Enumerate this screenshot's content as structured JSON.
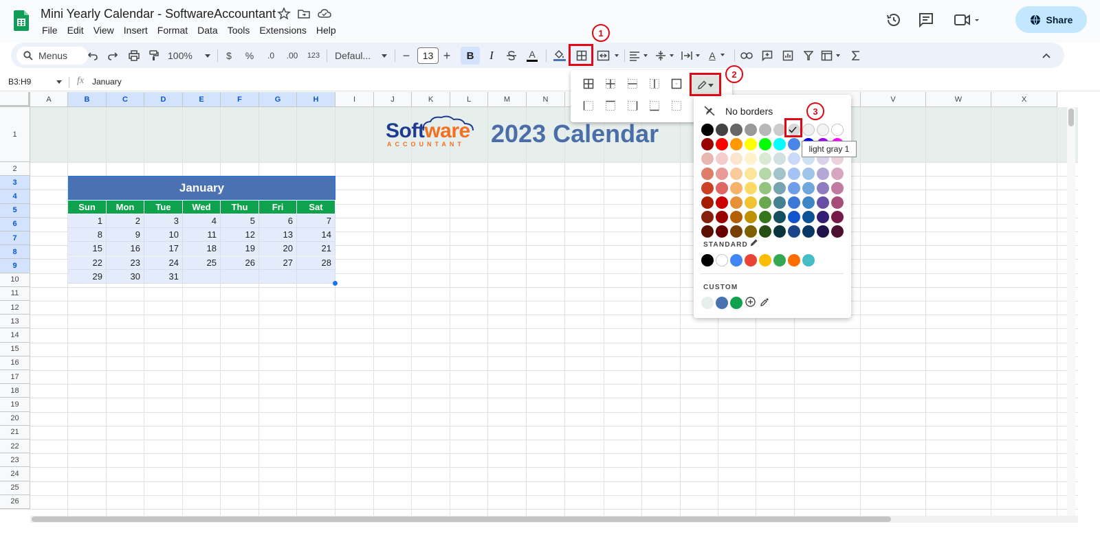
{
  "app": {
    "title": "Mini Yearly Calendar - SoftwareAccountant",
    "menu": [
      "File",
      "Edit",
      "View",
      "Insert",
      "Format",
      "Data",
      "Tools",
      "Extensions",
      "Help"
    ],
    "share_label": "Share"
  },
  "toolbar": {
    "search_label": "Menus",
    "zoom": "100%",
    "currency": "$",
    "percent": "%",
    "decimal_decrease": ".0",
    "decimal_increase": ".00",
    "number_format": "123",
    "font_name": "Defaul...",
    "font_size": "13",
    "bold": "B",
    "italic": "I",
    "text_color": "A",
    "text_rotate": "A",
    "minus": "−",
    "plus": "+"
  },
  "formula_bar": {
    "name_box": "B3:H9",
    "fx": "fx",
    "value": "January"
  },
  "columns": [
    "A",
    "B",
    "C",
    "D",
    "E",
    "F",
    "G",
    "H",
    "I",
    "J",
    "K",
    "L",
    "M",
    "N",
    "V",
    "W",
    "X"
  ],
  "rows": [
    "1",
    "2",
    "3",
    "4",
    "5",
    "6",
    "7",
    "8",
    "9",
    "10",
    "11",
    "12",
    "13",
    "14",
    "15",
    "16",
    "17",
    "18",
    "19",
    "20",
    "21",
    "22",
    "23",
    "24",
    "25",
    "26"
  ],
  "banner": {
    "logo_part1": "Soft",
    "logo_part2": "ware",
    "logo_sub": "ACCOUNTANT",
    "title": "2023 Calendar"
  },
  "calendar": {
    "month": "January",
    "days_of_week": [
      "Sun",
      "Mon",
      "Tue",
      "Wed",
      "Thu",
      "Fri",
      "Sat"
    ],
    "weeks": [
      [
        "1",
        "2",
        "3",
        "4",
        "5",
        "6",
        "7"
      ],
      [
        "8",
        "9",
        "10",
        "11",
        "12",
        "13",
        "14"
      ],
      [
        "15",
        "16",
        "17",
        "18",
        "19",
        "20",
        "21"
      ],
      [
        "22",
        "23",
        "24",
        "25",
        "26",
        "27",
        "28"
      ],
      [
        "29",
        "30",
        "31",
        "",
        "",
        "",
        ""
      ]
    ]
  },
  "border_color_popup": {
    "no_borders_label": "No borders",
    "standard_label": "STANDARD",
    "custom_label": "CUSTOM",
    "tooltip": "light gray 1",
    "selected_color": "light gray 1",
    "palette_rows": [
      [
        "#000000",
        "#434343",
        "#666666",
        "#999999",
        "#b7b7b7",
        "#cccccc",
        "#d9d9d9",
        "#efefef",
        "#f3f3f3",
        "#ffffff"
      ],
      [
        "#980000",
        "#ff0000",
        "#ff9900",
        "#ffff00",
        "#00ff00",
        "#00ffff",
        "#4a86e8",
        "#0000ff",
        "#9900ff",
        "#ff00ff"
      ],
      [
        "#e6b8af",
        "#f4cccc",
        "#fce5cd",
        "#fff2cc",
        "#d9ead3",
        "#d0e0e3",
        "#c9daf8",
        "#cfe2f3",
        "#d9d2e9",
        "#ead1dc"
      ],
      [
        "#dd7e6b",
        "#ea9999",
        "#f9cb9c",
        "#ffe599",
        "#b6d7a8",
        "#a2c4c9",
        "#a4c2f4",
        "#9fc5e8",
        "#b4a7d6",
        "#d5a6bd"
      ],
      [
        "#cc4125",
        "#e06666",
        "#f6b26b",
        "#ffd966",
        "#93c47d",
        "#76a5af",
        "#6d9eeb",
        "#6fa8dc",
        "#8e7cc3",
        "#c27ba0"
      ],
      [
        "#a61c00",
        "#cc0000",
        "#e69138",
        "#f1c232",
        "#6aa84f",
        "#45818e",
        "#3c78d8",
        "#3d85c6",
        "#674ea7",
        "#a64d79"
      ],
      [
        "#85200c",
        "#990000",
        "#b45f06",
        "#bf9000",
        "#38761d",
        "#134f5c",
        "#1155cc",
        "#0b5394",
        "#351c75",
        "#741b47"
      ],
      [
        "#5b0f00",
        "#660000",
        "#783f04",
        "#7f6000",
        "#274e13",
        "#0c343d",
        "#1c4587",
        "#073763",
        "#20124d",
        "#4c1130"
      ]
    ],
    "standard_colors": [
      "#000000",
      "#ffffff",
      "#4285f4",
      "#ea4335",
      "#fbbc04",
      "#34a853",
      "#ff6d01",
      "#46bdc6"
    ],
    "custom_colors": [
      "#e7efed",
      "#4a72b3",
      "#0fa24e"
    ]
  },
  "annotations": [
    "1",
    "2",
    "3"
  ],
  "colors": {
    "accent": "#1a73e8",
    "month_header": "#4a72b3",
    "dow_header": "#0fa24e",
    "day_cells": "#e4ecfb",
    "banner_bg": "#e7efed",
    "annotation_red": "#e30613"
  }
}
